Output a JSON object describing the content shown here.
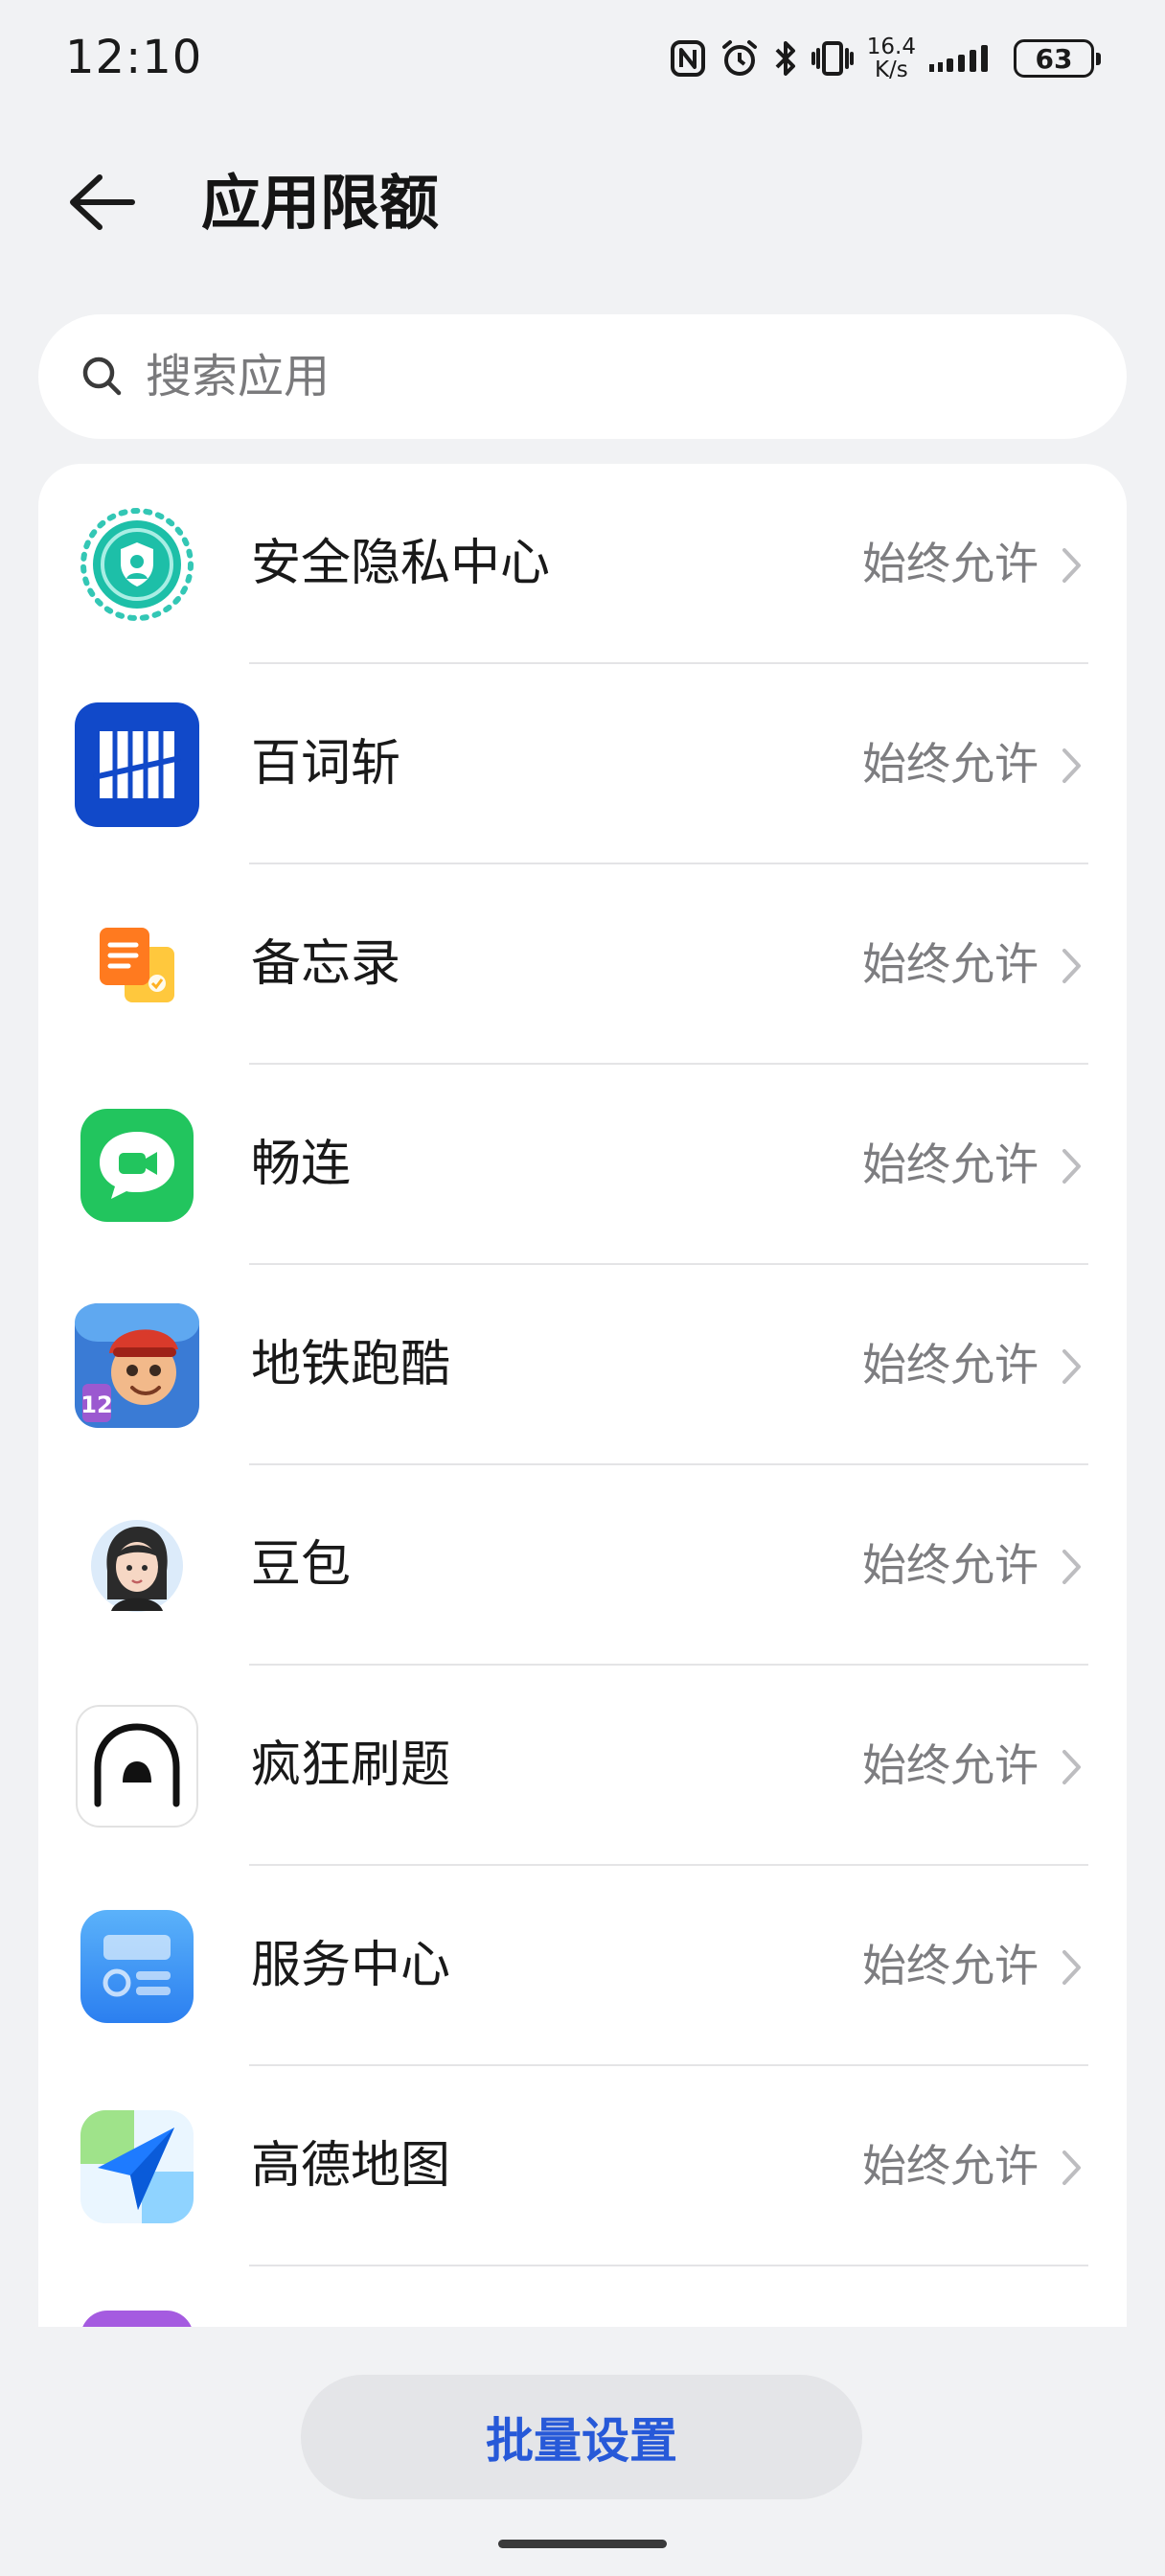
{
  "status_bar": {
    "time": "12:10",
    "net_speed_value": "16.4",
    "net_speed_unit": "K/s",
    "battery": "63",
    "icons": [
      "nfc-icon",
      "alarm-icon",
      "bluetooth-icon",
      "vibrate-icon",
      "signal-icon",
      "battery-icon"
    ]
  },
  "header": {
    "title": "应用限额",
    "back_icon": "arrow-left-icon"
  },
  "search": {
    "placeholder": "搜索应用",
    "value": "",
    "icon": "search-icon"
  },
  "apps": [
    {
      "name": "安全隐私中心",
      "status": "始终允许",
      "icon": "security-privacy-center-icon"
    },
    {
      "name": "百词斩",
      "status": "始终允许",
      "icon": "baicizhan-icon"
    },
    {
      "name": "备忘录",
      "status": "始终允许",
      "icon": "notes-icon"
    },
    {
      "name": "畅连",
      "status": "始终允许",
      "icon": "changlian-icon"
    },
    {
      "name": "地铁跑酷",
      "status": "始终允许",
      "icon": "subway-surfers-icon"
    },
    {
      "name": "豆包",
      "status": "始终允许",
      "icon": "doubao-icon"
    },
    {
      "name": "疯狂刷题",
      "status": "始终允许",
      "icon": "fengkuang-shuati-icon"
    },
    {
      "name": "服务中心",
      "status": "始终允许",
      "icon": "service-center-icon"
    },
    {
      "name": "高德地图",
      "status": "始终允许",
      "icon": "amap-icon"
    }
  ],
  "footer": {
    "batch_button_label": "批量设置"
  },
  "colors": {
    "background": "#F1F2F4",
    "card": "#FFFFFF",
    "accent": "#2759D8",
    "secondary_text": "#7D7D80"
  }
}
